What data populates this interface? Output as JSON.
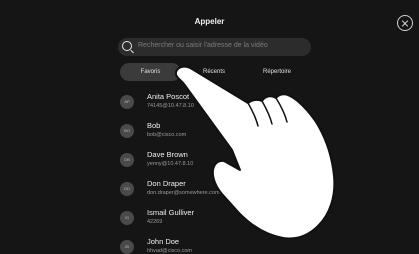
{
  "header": {
    "title": "Appeler"
  },
  "search": {
    "placeholder": "Rechercher ou saisir l'adresse de la vidéo"
  },
  "tabs": [
    {
      "label": "Favoris",
      "active": true
    },
    {
      "label": "Récents",
      "active": false
    },
    {
      "label": "Répertoire",
      "active": false
    }
  ],
  "contacts": [
    {
      "initials": "AP",
      "name": "Anita Poscot",
      "detail": "74145@10.47.8.10"
    },
    {
      "initials": "BO",
      "name": "Bob",
      "detail": "bob@cisco.com"
    },
    {
      "initials": "DB",
      "name": "Dave Brown",
      "detail": "yenny@10.47.8.10"
    },
    {
      "initials": "DD",
      "name": "Don Draper",
      "detail": "don.draper@somewhere.com"
    },
    {
      "initials": "IG",
      "name": "Ismail Gulliver",
      "detail": "42269"
    },
    {
      "initials": "JD",
      "name": "John Doe",
      "detail": "hhvad@cisco.com"
    }
  ],
  "icons": {
    "close": "close-icon",
    "search": "search-icon",
    "hand": "hand-pointer-icon"
  },
  "colors": {
    "background": "#151515",
    "search_bg": "#2c2c2c",
    "active_tab": "#3b3b3b",
    "avatar": "#4a4a4a"
  }
}
